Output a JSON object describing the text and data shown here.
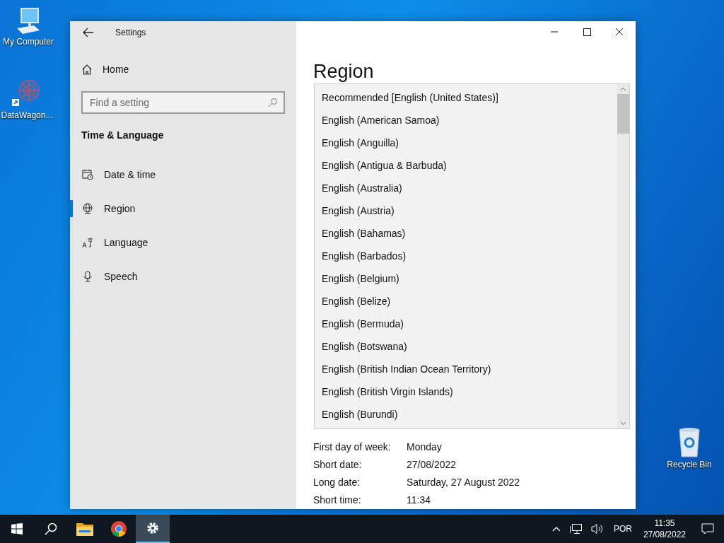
{
  "desktop_icons": [
    {
      "kind": "computer",
      "label": "My Computer"
    },
    {
      "kind": "app",
      "label": "DataWagon..."
    },
    {
      "kind": "recycle",
      "label": "Recycle Bin"
    }
  ],
  "window": {
    "title": "Settings",
    "sidebar": {
      "home": "Home",
      "search": {
        "placeholder": "Find a setting"
      },
      "section": "Time & Language",
      "items": [
        {
          "kind": "date",
          "label": "Date & time",
          "selected": false
        },
        {
          "kind": "region",
          "label": "Region",
          "selected": true
        },
        {
          "kind": "language",
          "label": "Language",
          "selected": false
        },
        {
          "kind": "speech",
          "label": "Speech",
          "selected": false
        }
      ]
    },
    "heading": "Region",
    "format_rows": [
      {
        "label": "First day of week:",
        "value": "Monday"
      },
      {
        "label": "Short date:",
        "value": "27/08/2022"
      },
      {
        "label": "Long date:",
        "value": "Saturday, 27 August 2022"
      },
      {
        "label": "Short time:",
        "value": "11:34"
      }
    ],
    "dropdown": {
      "options": [
        {
          "label": "Recommended [English (United States)]",
          "selected": false
        },
        {
          "label": "English (American Samoa)",
          "selected": false
        },
        {
          "label": "English (Anguilla)",
          "selected": false
        },
        {
          "label": "English (Antigua & Barbuda)",
          "selected": false
        },
        {
          "label": "English (Australia)",
          "selected": false
        },
        {
          "label": "English (Austria)",
          "selected": false
        },
        {
          "label": "English (Bahamas)",
          "selected": false
        },
        {
          "label": "English (Barbados)",
          "selected": false
        },
        {
          "label": "English (Belgium)",
          "selected": false
        },
        {
          "label": "English (Belize)",
          "selected": false
        },
        {
          "label": "English (Bermuda)",
          "selected": false
        },
        {
          "label": "English (Botswana)",
          "selected": false
        },
        {
          "label": "English (British Indian Ocean Territory)",
          "selected": false
        },
        {
          "label": "English (British Virgin Islands)",
          "selected": false
        },
        {
          "label": "English (Burundi)",
          "selected": false
        }
      ]
    }
  },
  "taskbar": {
    "apps": [
      {
        "kind": "folder",
        "selected": false
      },
      {
        "kind": "browser",
        "selected": false
      },
      {
        "kind": "settings",
        "selected": true
      }
    ],
    "language": "POR",
    "time": "11:35",
    "date": "27/08/2022"
  }
}
